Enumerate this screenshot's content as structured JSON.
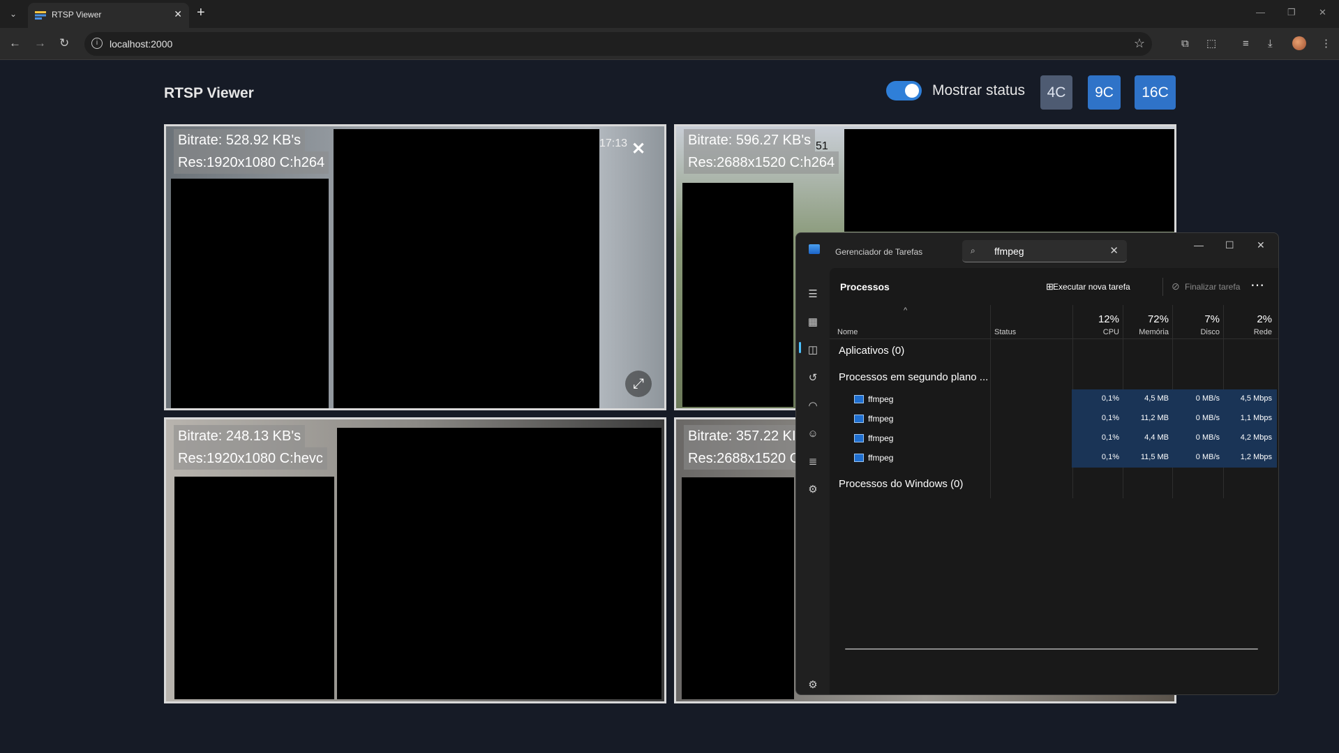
{
  "browser": {
    "tab_title": "RTSP Viewer",
    "url": "localhost:2000"
  },
  "app": {
    "title": "RTSP Viewer",
    "show_status_label": "Mostrar status",
    "show_status_on": true,
    "grid_buttons": [
      "4C",
      "9C",
      "16C"
    ],
    "selected_grid": "4C",
    "cameras": [
      {
        "bitrate": "Bitrate: 528.92 KB's",
        "res": "Res:1920x1080 C:h264",
        "timestamp": "17:13"
      },
      {
        "bitrate": "Bitrate: 596.27 KB's",
        "res": "Res:2688x1520 C:h264",
        "timestamp": "51"
      },
      {
        "bitrate": "Bitrate: 248.13 KB's",
        "res": "Res:1920x1080 C:hevc"
      },
      {
        "bitrate": "Bitrate: 357.22 KI",
        "res": "Res:2688x1520 C"
      }
    ]
  },
  "task_manager": {
    "title": "Gerenciador de Tarefas",
    "search_value": "ffmpeg",
    "heading": "Processos",
    "run_new_task": "Executar nova tarefa",
    "end_task": "Finalizar tarefa",
    "columns": {
      "name": "Nome",
      "status": "Status",
      "cpu_pct": "12%",
      "cpu": "CPU",
      "mem_pct": "72%",
      "mem": "Memória",
      "disk_pct": "7%",
      "disk": "Disco",
      "net_pct": "2%",
      "net": "Rede"
    },
    "groups": {
      "apps": "Aplicativos (0)",
      "background": "Processos em segundo plano ...",
      "windows": "Processos do Windows (0)"
    },
    "processes": [
      {
        "name": "ffmpeg",
        "cpu": "0,1%",
        "mem": "4,5 MB",
        "disk": "0 MB/s",
        "net": "4,5 Mbps"
      },
      {
        "name": "ffmpeg",
        "cpu": "0,1%",
        "mem": "11,2 MB",
        "disk": "0 MB/s",
        "net": "1,1 Mbps"
      },
      {
        "name": "ffmpeg",
        "cpu": "0,1%",
        "mem": "4,4 MB",
        "disk": "0 MB/s",
        "net": "4,2 Mbps"
      },
      {
        "name": "ffmpeg",
        "cpu": "0,1%",
        "mem": "11,5 MB",
        "disk": "0 MB/s",
        "net": "1,2 Mbps"
      }
    ],
    "colors": {
      "accent": "#4cc2ff",
      "heat": "#1a3456"
    }
  },
  "icons": {
    "tab_close": "✕",
    "new_tab": "+",
    "back": "←",
    "forward": "→",
    "reload": "↻",
    "star": "☆",
    "search": "⌕",
    "clear": "✕",
    "more": "⋯",
    "expand": "⤢",
    "close_x": "✕"
  }
}
